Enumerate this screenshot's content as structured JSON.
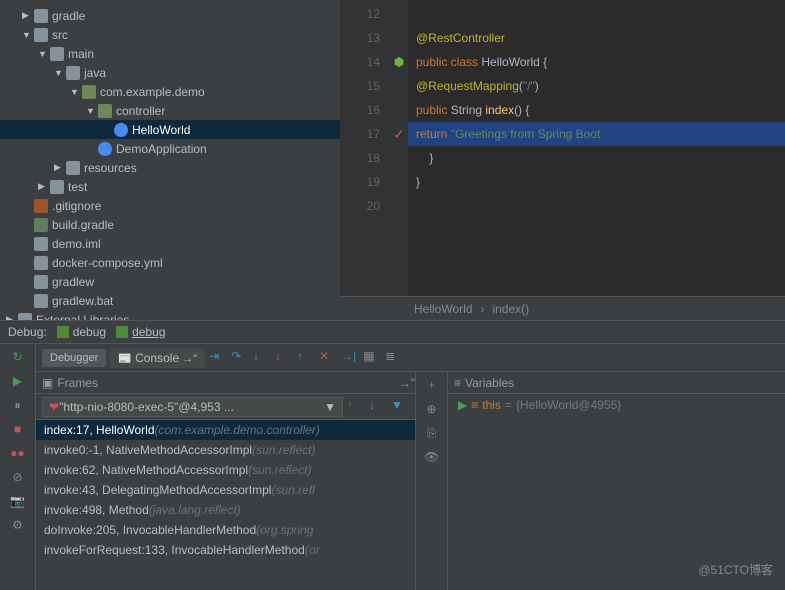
{
  "tree": {
    "items": [
      {
        "indent": 0,
        "arrow": "▶",
        "icon": "dir",
        "label": "gradle"
      },
      {
        "indent": 0,
        "arrow": "▼",
        "icon": "dir",
        "label": "src"
      },
      {
        "indent": 1,
        "arrow": "▼",
        "icon": "dir",
        "label": "main"
      },
      {
        "indent": 2,
        "arrow": "▼",
        "icon": "dir",
        "label": "java"
      },
      {
        "indent": 3,
        "arrow": "▼",
        "icon": "pkg",
        "label": "com.example.demo"
      },
      {
        "indent": 4,
        "arrow": "▼",
        "icon": "pkg",
        "label": "controller"
      },
      {
        "indent": 5,
        "arrow": "",
        "icon": "cls",
        "label": "HelloWorld",
        "sel": true
      },
      {
        "indent": 4,
        "arrow": "",
        "icon": "cls",
        "label": "DemoApplication"
      },
      {
        "indent": 2,
        "arrow": "▶",
        "icon": "dir",
        "label": "resources"
      },
      {
        "indent": 1,
        "arrow": "▶",
        "icon": "dir",
        "label": "test"
      },
      {
        "indent": 0,
        "arrow": "",
        "icon": "git",
        "label": ".gitignore"
      },
      {
        "indent": 0,
        "arrow": "",
        "icon": "elephant",
        "label": "build.gradle"
      },
      {
        "indent": 0,
        "arrow": "",
        "icon": "file",
        "label": "demo.iml"
      },
      {
        "indent": 0,
        "arrow": "",
        "icon": "file",
        "label": "docker-compose.yml"
      },
      {
        "indent": 0,
        "arrow": "",
        "icon": "file",
        "label": "gradlew"
      },
      {
        "indent": 0,
        "arrow": "",
        "icon": "file",
        "label": "gradlew.bat"
      },
      {
        "indent": -1,
        "arrow": "▶",
        "icon": "lib",
        "label": "External Libraries"
      }
    ]
  },
  "editor": {
    "lines": [
      12,
      13,
      14,
      15,
      16,
      17,
      18,
      19,
      20
    ],
    "breakpoint_line": 17,
    "spring_line": 14
  },
  "breadcrumb": {
    "class": "HelloWorld",
    "method": "index()"
  },
  "debug": {
    "label": "Debug:",
    "tabs": [
      {
        "label": "debug"
      },
      {
        "label": "debug",
        "active": true
      }
    ],
    "dbg_tabs": [
      {
        "label": "Debugger",
        "active": true
      },
      {
        "label": "Console"
      }
    ],
    "frames_label": "Frames",
    "vars_label": "Variables",
    "thread": "\"http-nio-8080-exec-5\"@4,953 ...",
    "stack": [
      {
        "main": "index:17, HelloWorld",
        "pkg": "(com.example.demo.controller)",
        "sel": true
      },
      {
        "main": "invoke0:-1, NativeMethodAccessorImpl",
        "pkg": "(sun.reflect)"
      },
      {
        "main": "invoke:62, NativeMethodAccessorImpl",
        "pkg": "(sun.reflect)"
      },
      {
        "main": "invoke:43, DelegatingMethodAccessorImpl",
        "pkg": "(sun.refl"
      },
      {
        "main": "invoke:498, Method",
        "pkg": "(java.lang.reflect)"
      },
      {
        "main": "doInvoke:205, InvocableHandlerMethod",
        "pkg": "(org.spring"
      },
      {
        "main": "invokeForRequest:133, InvocableHandlerMethod",
        "pkg": "(or"
      }
    ],
    "var_this": "this",
    "var_eq": " = ",
    "var_val": "{HelloWorld@4955}"
  },
  "watermark": "@51CTO博客"
}
